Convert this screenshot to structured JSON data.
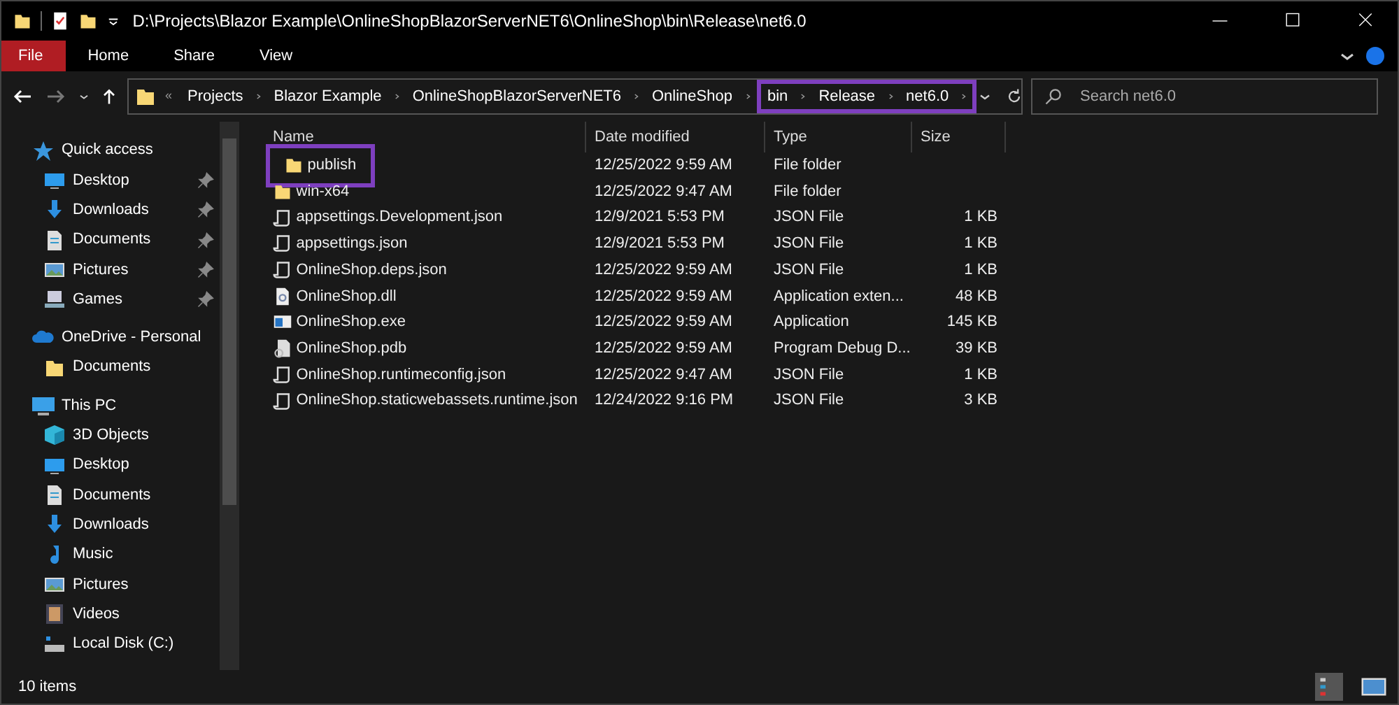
{
  "window": {
    "title": "D:\\Projects\\Blazor Example\\OnlineShopBlazorServerNET6\\OnlineShop\\bin\\Release\\net6.0"
  },
  "ribbon_tabs": [
    {
      "label": "File",
      "selected": true
    },
    {
      "label": "Home",
      "selected": false
    },
    {
      "label": "Share",
      "selected": false
    },
    {
      "label": "View",
      "selected": false
    }
  ],
  "address": {
    "overflow": "«",
    "segments": [
      {
        "label": "Projects",
        "highlighted": false
      },
      {
        "label": "Blazor Example",
        "highlighted": false
      },
      {
        "label": "OnlineShopBlazorServerNET6",
        "highlighted": false
      },
      {
        "label": "OnlineShop",
        "highlighted": false
      },
      {
        "label": "bin",
        "highlighted": true
      },
      {
        "label": "Release",
        "highlighted": true
      },
      {
        "label": "net6.0",
        "highlighted": true
      }
    ]
  },
  "search": {
    "placeholder": "Search net6.0"
  },
  "sidebar": {
    "items": [
      {
        "label": "Quick access",
        "kind": "star",
        "children": [
          {
            "label": "Desktop",
            "kind": "desktop",
            "pinned": true
          },
          {
            "label": "Downloads",
            "kind": "download",
            "pinned": true
          },
          {
            "label": "Documents",
            "kind": "document",
            "pinned": true
          },
          {
            "label": "Pictures",
            "kind": "pictures",
            "pinned": true
          },
          {
            "label": "Games",
            "kind": "games",
            "pinned": true
          }
        ]
      },
      {
        "label": "OneDrive - Personal",
        "kind": "cloud",
        "children": [
          {
            "label": "Documents",
            "kind": "folder",
            "pinned": false
          }
        ]
      },
      {
        "label": "This PC",
        "kind": "pc",
        "children": [
          {
            "label": "3D Objects",
            "kind": "cube",
            "pinned": false
          },
          {
            "label": "Desktop",
            "kind": "desktop",
            "pinned": false
          },
          {
            "label": "Documents",
            "kind": "document",
            "pinned": false
          },
          {
            "label": "Downloads",
            "kind": "download",
            "pinned": false
          },
          {
            "label": "Music",
            "kind": "music",
            "pinned": false
          },
          {
            "label": "Pictures",
            "kind": "pictures",
            "pinned": false
          },
          {
            "label": "Videos",
            "kind": "videos",
            "pinned": false
          },
          {
            "label": "Local Disk (C:)",
            "kind": "disk",
            "pinned": false
          }
        ]
      }
    ]
  },
  "table": {
    "columns": [
      "Name",
      "Date modified",
      "Type",
      "Size"
    ],
    "rows": [
      {
        "name": "publish",
        "kind": "folder",
        "date": "12/25/2022 9:59 AM",
        "type": "File folder",
        "size": "",
        "highlighted": true
      },
      {
        "name": "win-x64",
        "kind": "folder",
        "date": "12/25/2022 9:47 AM",
        "type": "File folder",
        "size": "",
        "highlighted": false
      },
      {
        "name": "appsettings.Development.json",
        "kind": "json",
        "date": "12/9/2021 5:53 PM",
        "type": "JSON File",
        "size": "1 KB",
        "highlighted": false
      },
      {
        "name": "appsettings.json",
        "kind": "json",
        "date": "12/9/2021 5:53 PM",
        "type": "JSON File",
        "size": "1 KB",
        "highlighted": false
      },
      {
        "name": "OnlineShop.deps.json",
        "kind": "json",
        "date": "12/25/2022 9:59 AM",
        "type": "JSON File",
        "size": "1 KB",
        "highlighted": false
      },
      {
        "name": "OnlineShop.dll",
        "kind": "dll",
        "date": "12/25/2022 9:59 AM",
        "type": "Application exten...",
        "size": "48 KB",
        "highlighted": false
      },
      {
        "name": "OnlineShop.exe",
        "kind": "exe",
        "date": "12/25/2022 9:59 AM",
        "type": "Application",
        "size": "145 KB",
        "highlighted": false
      },
      {
        "name": "OnlineShop.pdb",
        "kind": "pdb",
        "date": "12/25/2022 9:59 AM",
        "type": "Program Debug D...",
        "size": "39 KB",
        "highlighted": false
      },
      {
        "name": "OnlineShop.runtimeconfig.json",
        "kind": "json",
        "date": "12/25/2022 9:47 AM",
        "type": "JSON File",
        "size": "1 KB",
        "highlighted": false
      },
      {
        "name": "OnlineShop.staticwebassets.runtime.json",
        "kind": "json",
        "date": "12/24/2022 9:16 PM",
        "type": "JSON File",
        "size": "3 KB",
        "highlighted": false
      }
    ]
  },
  "status_bar": {
    "count": "10 items"
  }
}
